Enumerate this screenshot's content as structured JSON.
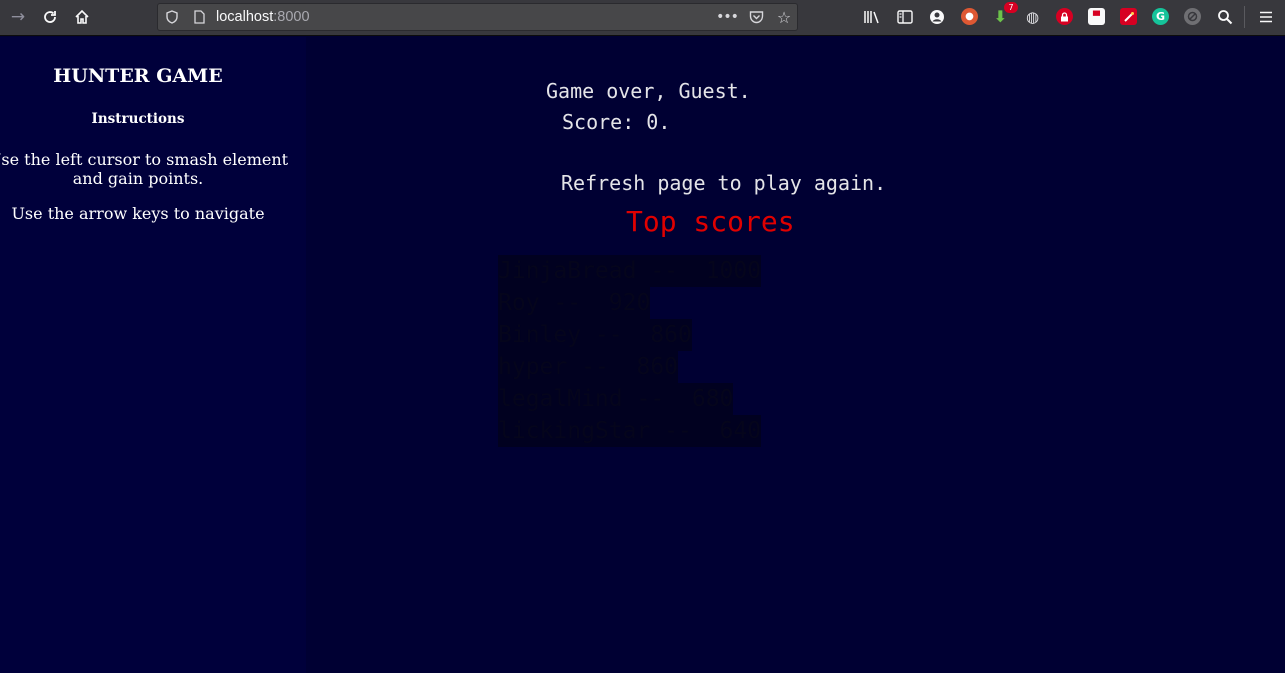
{
  "browser": {
    "url_host": "localhost",
    "url_port": ":8000",
    "downloads_badge": "7",
    "icons": {
      "forward": "arrow-forward-icon",
      "reload": "reload-icon",
      "home": "home-icon",
      "tracking": "shield-icon",
      "page": "page-icon",
      "page_actions": "ellipsis-icon",
      "pocket": "pocket-icon",
      "bookmark": "star-icon",
      "library": "library-icon",
      "sidebar": "sidebar-icon",
      "account": "account-icon",
      "menu": "hamburger-menu-icon"
    }
  },
  "sidebar": {
    "title": "HUNTER GAME",
    "instructions_heading": "Instructions",
    "instructions": [
      "Use the left cursor to smash element and gain points.",
      "Use the arrow keys to navigate"
    ]
  },
  "game": {
    "game_over": "Game over, Guest.",
    "score": "Score: 0.",
    "refresh": "Refresh page to play again.",
    "top_scores_title": "Top scores",
    "top_scores": [
      {
        "text": "JinjaBread --  1000"
      },
      {
        "text": "Roy --  920"
      },
      {
        "text": "Binley --  860"
      },
      {
        "text": "hyper --  860"
      },
      {
        "text": "legalMind --  680"
      },
      {
        "text": "lickingStar --  640"
      }
    ]
  },
  "colors": {
    "page_background": "#000033",
    "sidebar_background": "#00003b",
    "top_scores_title": "#e00000",
    "top_scores_text": "#05051c",
    "toolbar": "#38383d"
  }
}
